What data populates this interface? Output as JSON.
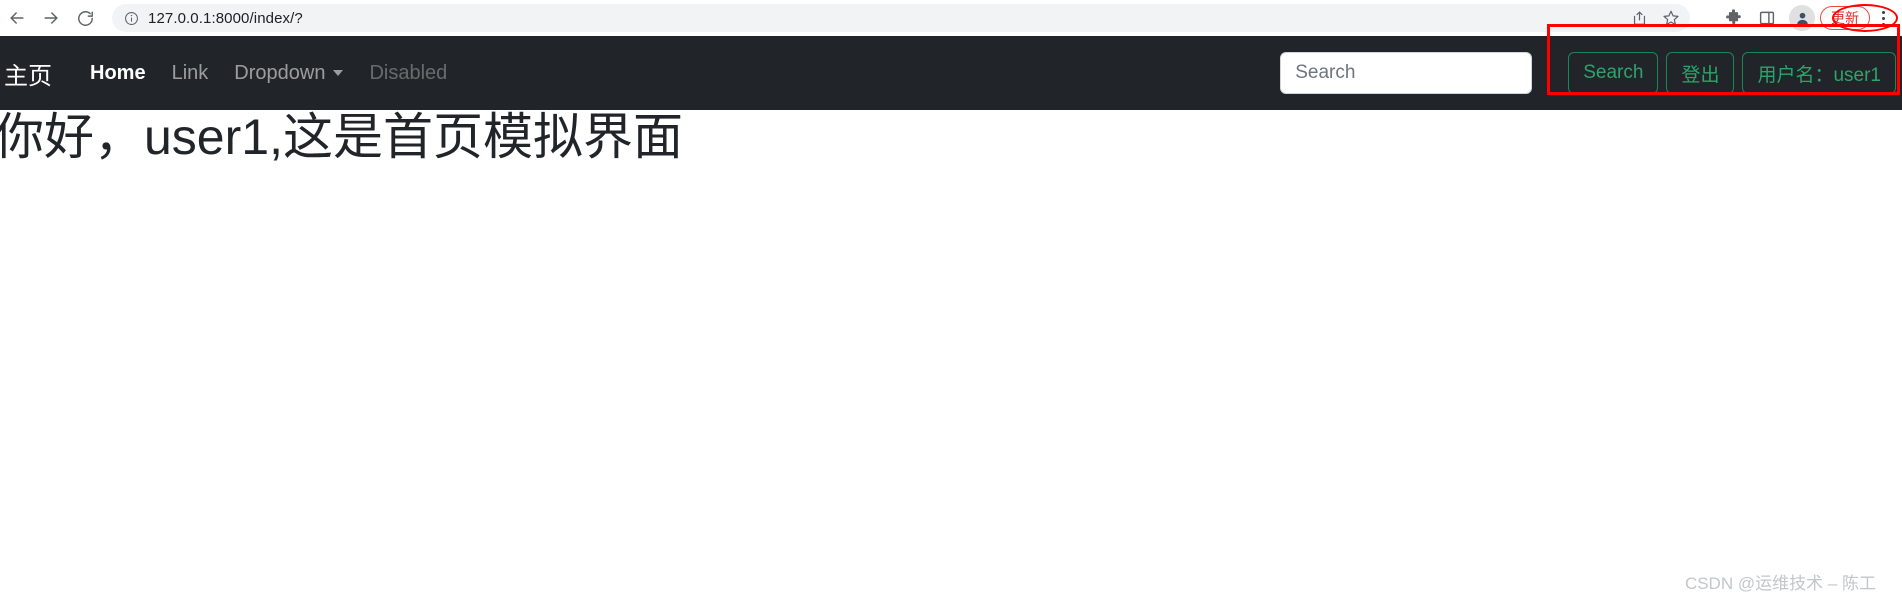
{
  "browser": {
    "back_icon": "back-arrow-icon",
    "forward_icon": "forward-arrow-icon",
    "reload_icon": "reload-icon",
    "info_icon": "info-circle-icon",
    "url_host": "127.0.0.1",
    "url_rest": ":8000/index/?",
    "url_full": "127.0.0.1:8000/index/?",
    "share_icon": "share-icon",
    "bookmark_icon": "star-icon",
    "extensions_icon": "puzzle-piece-icon",
    "sidepanel_icon": "side-panel-icon",
    "profile_icon": "profile-avatar-icon",
    "update_label": "更新",
    "menu_icon": "three-dot-menu-icon"
  },
  "navbar": {
    "brand": "主页",
    "links": [
      {
        "label": "Home",
        "state": "active"
      },
      {
        "label": "Link",
        "state": "normal"
      },
      {
        "label": "Dropdown",
        "state": "dropdown"
      },
      {
        "label": "Disabled",
        "state": "disabled"
      }
    ],
    "caret_icon": "chevron-down-icon",
    "search": {
      "value": "",
      "placeholder": "Search"
    },
    "buttons": [
      {
        "label": "Search",
        "name": "search-submit-button"
      },
      {
        "label": "登出",
        "name": "logout-button"
      },
      {
        "label": "用户名：user1",
        "name": "username-button"
      }
    ]
  },
  "main": {
    "heading": "你好，user1,这是首页模拟界面"
  },
  "watermark": {
    "text": "CSDN @运维技术 – 陈工"
  },
  "colors": {
    "navbar_bg": "#212529",
    "accent_green": "#198754",
    "annotation_red": "#ff0000",
    "update_red": "#d93025"
  }
}
